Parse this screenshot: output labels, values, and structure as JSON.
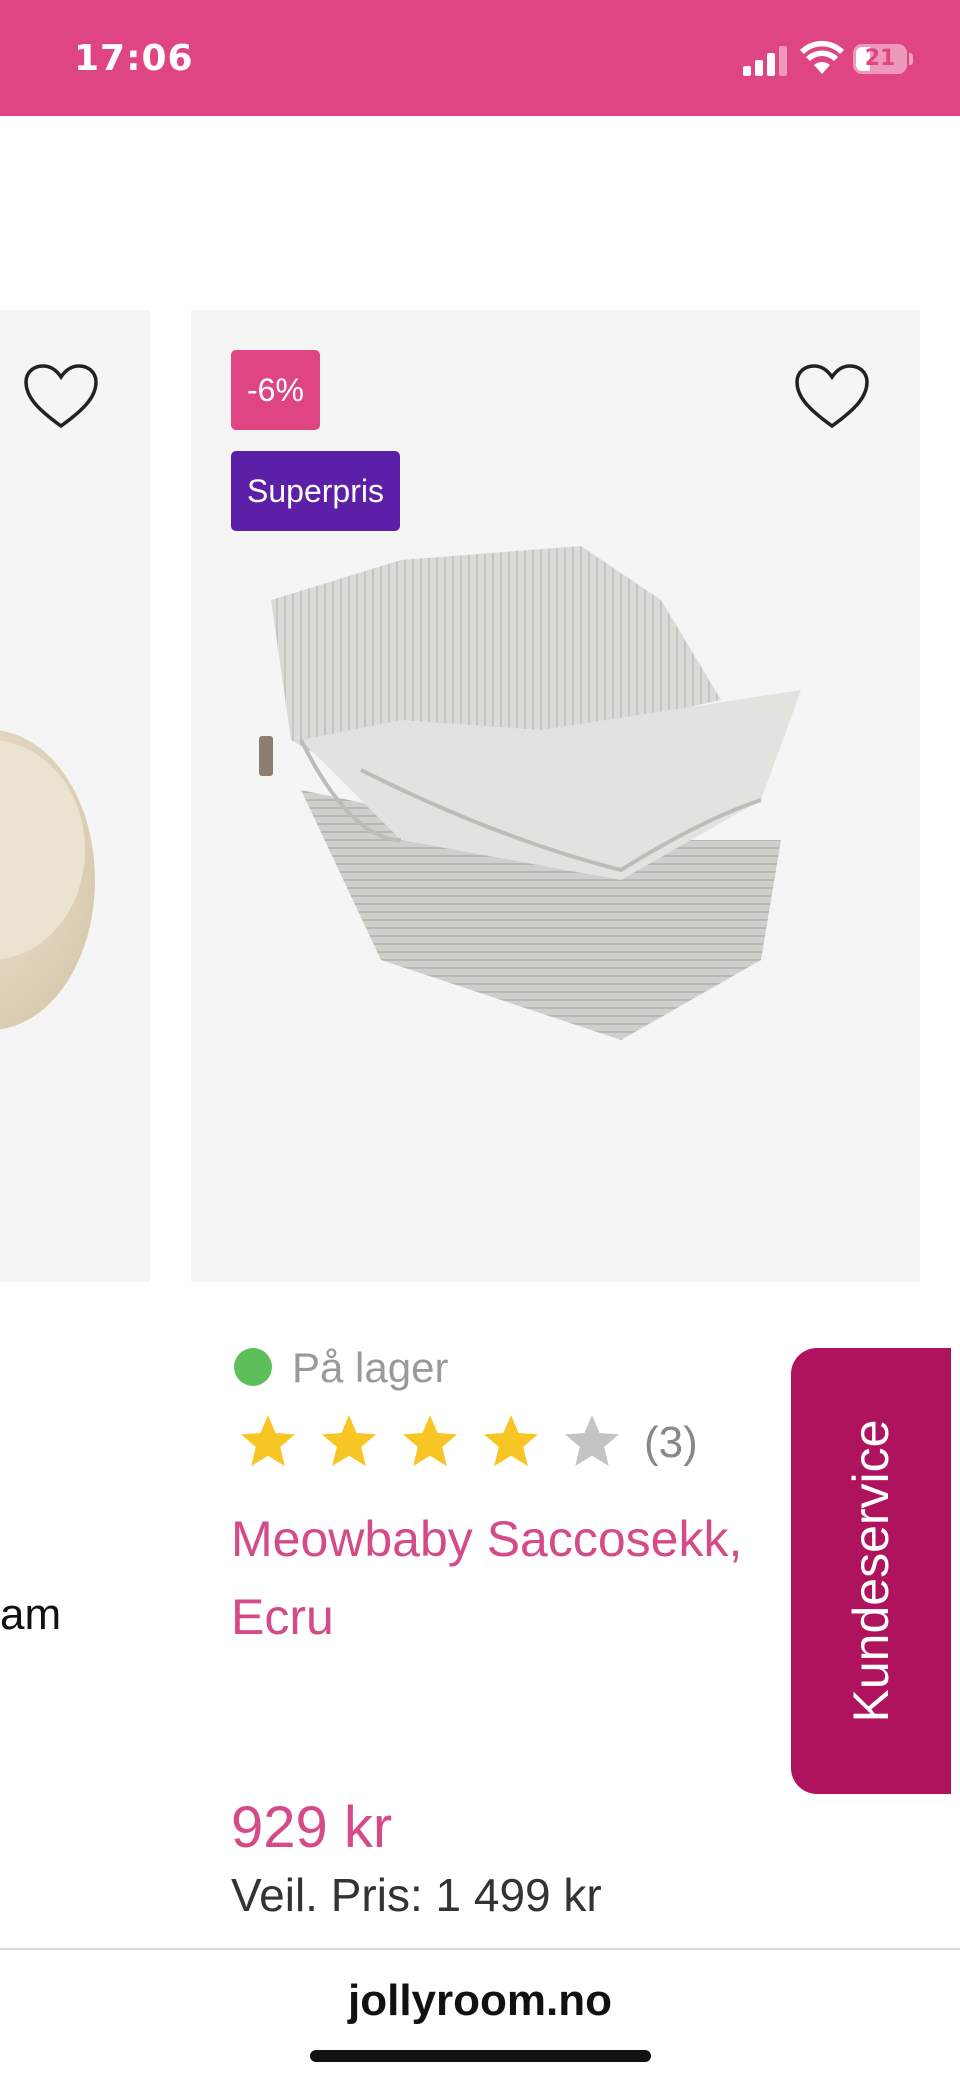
{
  "status_bar": {
    "time": "17:06",
    "battery": "21",
    "icons": [
      "signal-icon",
      "wifi-icon",
      "battery-icon"
    ],
    "background": "#e04583"
  },
  "left_card": {
    "partial_name": "am",
    "icons": [
      "heart-icon"
    ]
  },
  "product": {
    "discount_badge": "-6%",
    "promo_badge": "Superpris",
    "stock_status": "På lager",
    "rating": 4,
    "rating_max": 5,
    "review_count": "(3)",
    "name": "Meowbaby Saccosekk, Ecru",
    "price": "929 kr",
    "recommended_price": "Veil. Pris: 1 499 kr",
    "colors": {
      "accent": "#d44b87",
      "discount_badge": "#e04583",
      "promo_badge": "#5b1fa8",
      "in_stock": "#5cbf5c",
      "star_filled": "#f7c625",
      "star_empty": "#c4c4c4"
    }
  },
  "customer_service": {
    "label": "Kundeservice",
    "color": "#b0135e"
  },
  "browser": {
    "url": "jollyroom.no"
  }
}
